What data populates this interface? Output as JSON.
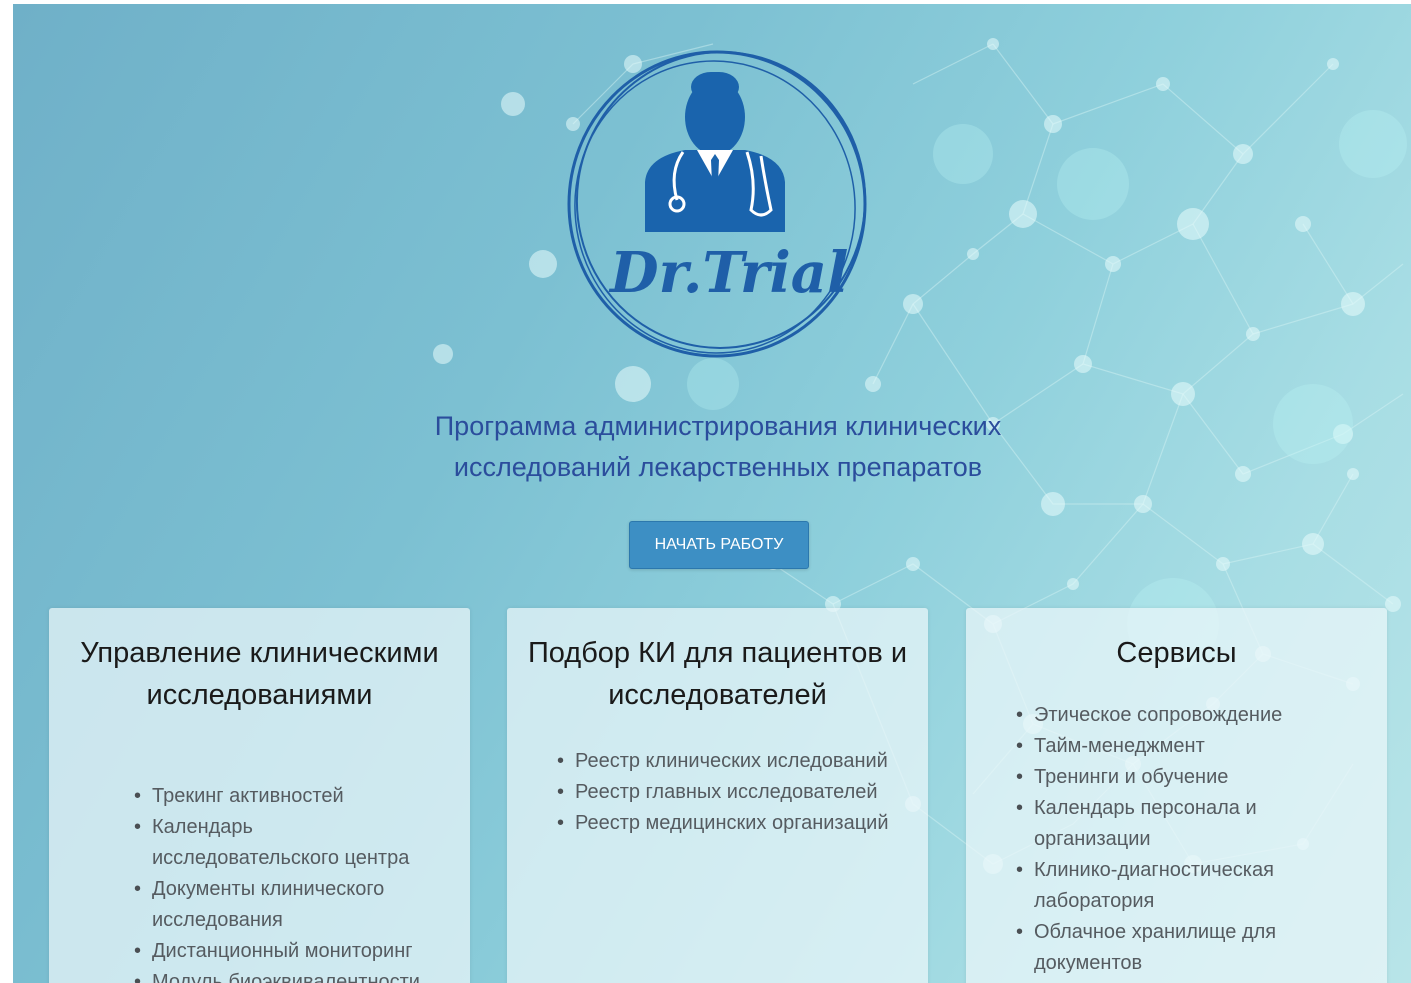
{
  "logo": {
    "text": "Dr.Trial",
    "icon": "doctor-stethoscope-icon"
  },
  "subtitle": {
    "line1": "Программа администрирования клинических",
    "line2": "исследований лекарственных препаратов"
  },
  "start_button": {
    "label": "НАЧАТЬ РАБОТУ"
  },
  "cards": [
    {
      "title_line1": "Управление клиническими",
      "title_line2": "исследованиями",
      "items": [
        "Трекинг активностей",
        "Календарь исследовательского центра",
        "Документы клинического исследования",
        "Дистанционный мониторинг",
        "Модуль биоэквивалентности"
      ]
    },
    {
      "title_line1": "Подбор КИ для пациентов и",
      "title_line2": "исследователей",
      "items": [
        "Реестр клинических иследований",
        "Реестр главных исследователей",
        "Реестр медицинских организаций"
      ]
    },
    {
      "title_line1": "Сервисы",
      "title_line2": "",
      "items": [
        "Этическое сопровождение",
        "Тайм-менеджмент",
        "Тренинги и обучение",
        "Календарь персонала и организации",
        "Клинико-диагностическая лаборатория",
        "Облачное хранилище для документов"
      ]
    }
  ],
  "colors": {
    "subtitle": "#2b4d9c",
    "button": "#3d8fc4",
    "logo": "#1f5fa8"
  }
}
